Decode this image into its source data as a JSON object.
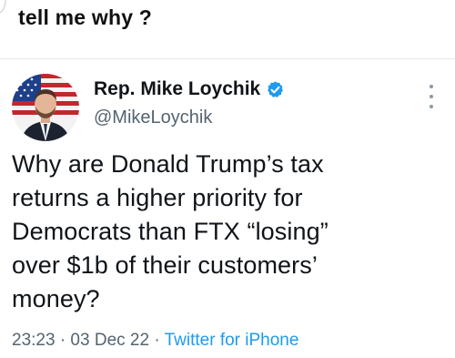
{
  "caption": "tell me why ?",
  "tweet": {
    "author": {
      "display_name": "Rep. Mike Loychik",
      "handle": "@MikeLoychik",
      "verified": true,
      "verified_icon": "verified-badge-icon",
      "avatar_icon": "profile-avatar"
    },
    "text_lines": [
      "Why are Donald Trump’s tax",
      "returns a higher priority for",
      "Democrats than FTX “losing”",
      "over $1b of their customers’",
      "money?"
    ],
    "timestamp": "23:23 · 03 Dec 22 ·",
    "source": "Twitter for iPhone",
    "menu_icon": "more-options-icon"
  },
  "colors": {
    "text": "#0f1419",
    "secondary": "#536471",
    "link": "#1d9bf0",
    "divider": "#e6e8ea"
  }
}
